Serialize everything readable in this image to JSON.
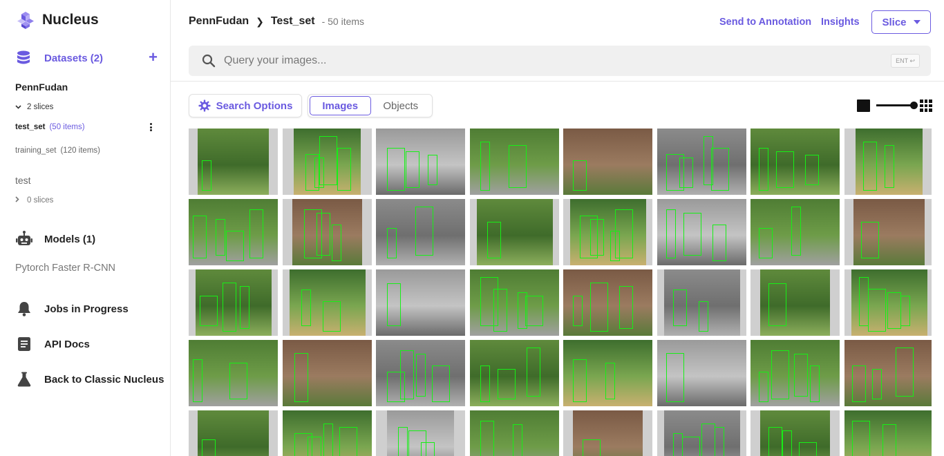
{
  "sidebar": {
    "app_name": "Nucleus",
    "datasets_label": "Datasets (2)",
    "add_symbol": "+",
    "dataset_name": "PennFudan",
    "slices_toggle": "2 slices",
    "slices": [
      {
        "name": "test_set",
        "count": "(50 items)"
      },
      {
        "name": "training_set",
        "count": "(120 items)"
      }
    ],
    "test_dataset": "test",
    "test_slices": "0 slices",
    "models_label": "Models (1)",
    "model_name": "Pytorch Faster R-CNN",
    "jobs_label": "Jobs in Progress",
    "api_label": "API Docs",
    "back_label": "Back to Classic Nucleus"
  },
  "header": {
    "crumb_dataset": "PennFudan",
    "crumb_sep": "❯",
    "crumb_slice": "Test_set",
    "crumb_count": "- 50 items",
    "send_label": "Send to Annotation",
    "insights_label": "Insights",
    "slice_button": "Slice"
  },
  "search": {
    "placeholder": "Query your images...",
    "ent_hint": "ENT ↩"
  },
  "toolbar": {
    "search_options": "Search Options",
    "tab_images": "Images",
    "tab_objects": "Objects"
  },
  "colors": {
    "accent": "#6a5ae0",
    "box": "#16f016"
  },
  "gallery": {
    "columns": 8,
    "rows": 5,
    "thumb_count": 40
  }
}
